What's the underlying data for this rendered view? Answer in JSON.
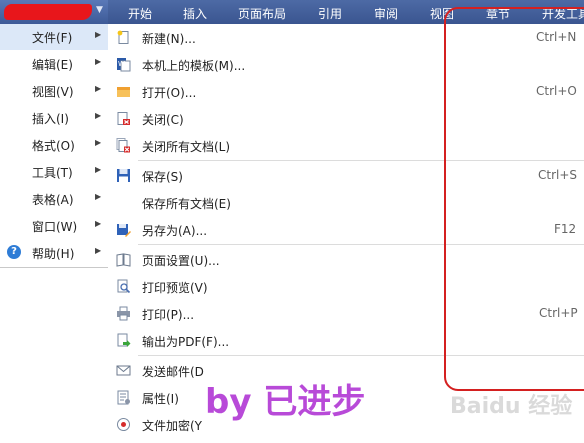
{
  "topbar": {
    "tabs": [
      "开始",
      "插入",
      "页面布局",
      "引用",
      "审阅",
      "视图",
      "章节",
      "开发工具"
    ]
  },
  "main_menu": {
    "items": [
      {
        "label": "文件(F)"
      },
      {
        "label": "编辑(E)"
      },
      {
        "label": "视图(V)"
      },
      {
        "label": "插入(I)"
      },
      {
        "label": "格式(O)"
      },
      {
        "label": "工具(T)"
      },
      {
        "label": "表格(A)"
      },
      {
        "label": "窗口(W)"
      },
      {
        "label": "帮助(H)"
      }
    ],
    "help_icon_glyph": "?"
  },
  "file_menu": {
    "items": [
      {
        "label": "新建(N)...",
        "shortcut": "Ctrl+N",
        "icon": "new-document-icon"
      },
      {
        "label": "本机上的模板(M)...",
        "shortcut": "",
        "icon": "template-icon"
      },
      {
        "label": "打开(O)...",
        "shortcut": "Ctrl+O",
        "icon": "open-folder-icon"
      },
      {
        "label": "关闭(C)",
        "shortcut": "",
        "icon": "close-document-icon"
      },
      {
        "label": "关闭所有文档(L)",
        "shortcut": "",
        "icon": "close-all-icon"
      },
      {
        "label": "保存(S)",
        "shortcut": "Ctrl+S",
        "icon": "save-icon"
      },
      {
        "label": "保存所有文档(E)",
        "shortcut": "",
        "icon": ""
      },
      {
        "label": "另存为(A)...",
        "shortcut": "F12",
        "icon": "save-as-icon"
      },
      {
        "label": "页面设置(U)...",
        "shortcut": "",
        "icon": "page-setup-icon"
      },
      {
        "label": "打印预览(V)",
        "shortcut": "",
        "icon": "print-preview-icon"
      },
      {
        "label": "打印(P)...",
        "shortcut": "Ctrl+P",
        "icon": "printer-icon"
      },
      {
        "label": "输出为PDF(F)...",
        "shortcut": "",
        "icon": "pdf-export-icon"
      },
      {
        "label": "发送邮件(D",
        "shortcut": "",
        "icon": "mail-icon"
      },
      {
        "label": "属性(I)",
        "shortcut": "",
        "icon": "properties-icon"
      },
      {
        "label": "文件加密(Y",
        "shortcut": "",
        "icon": "encrypt-icon"
      }
    ]
  },
  "watermark_text": "by 已进步",
  "baidu_watermark": "Baidu 经验",
  "colors": {
    "ribbon": "#3a5590",
    "highlight": "#dce8f8",
    "annotation_red": "#d42020",
    "watermark_purple": "#b84ad8"
  }
}
